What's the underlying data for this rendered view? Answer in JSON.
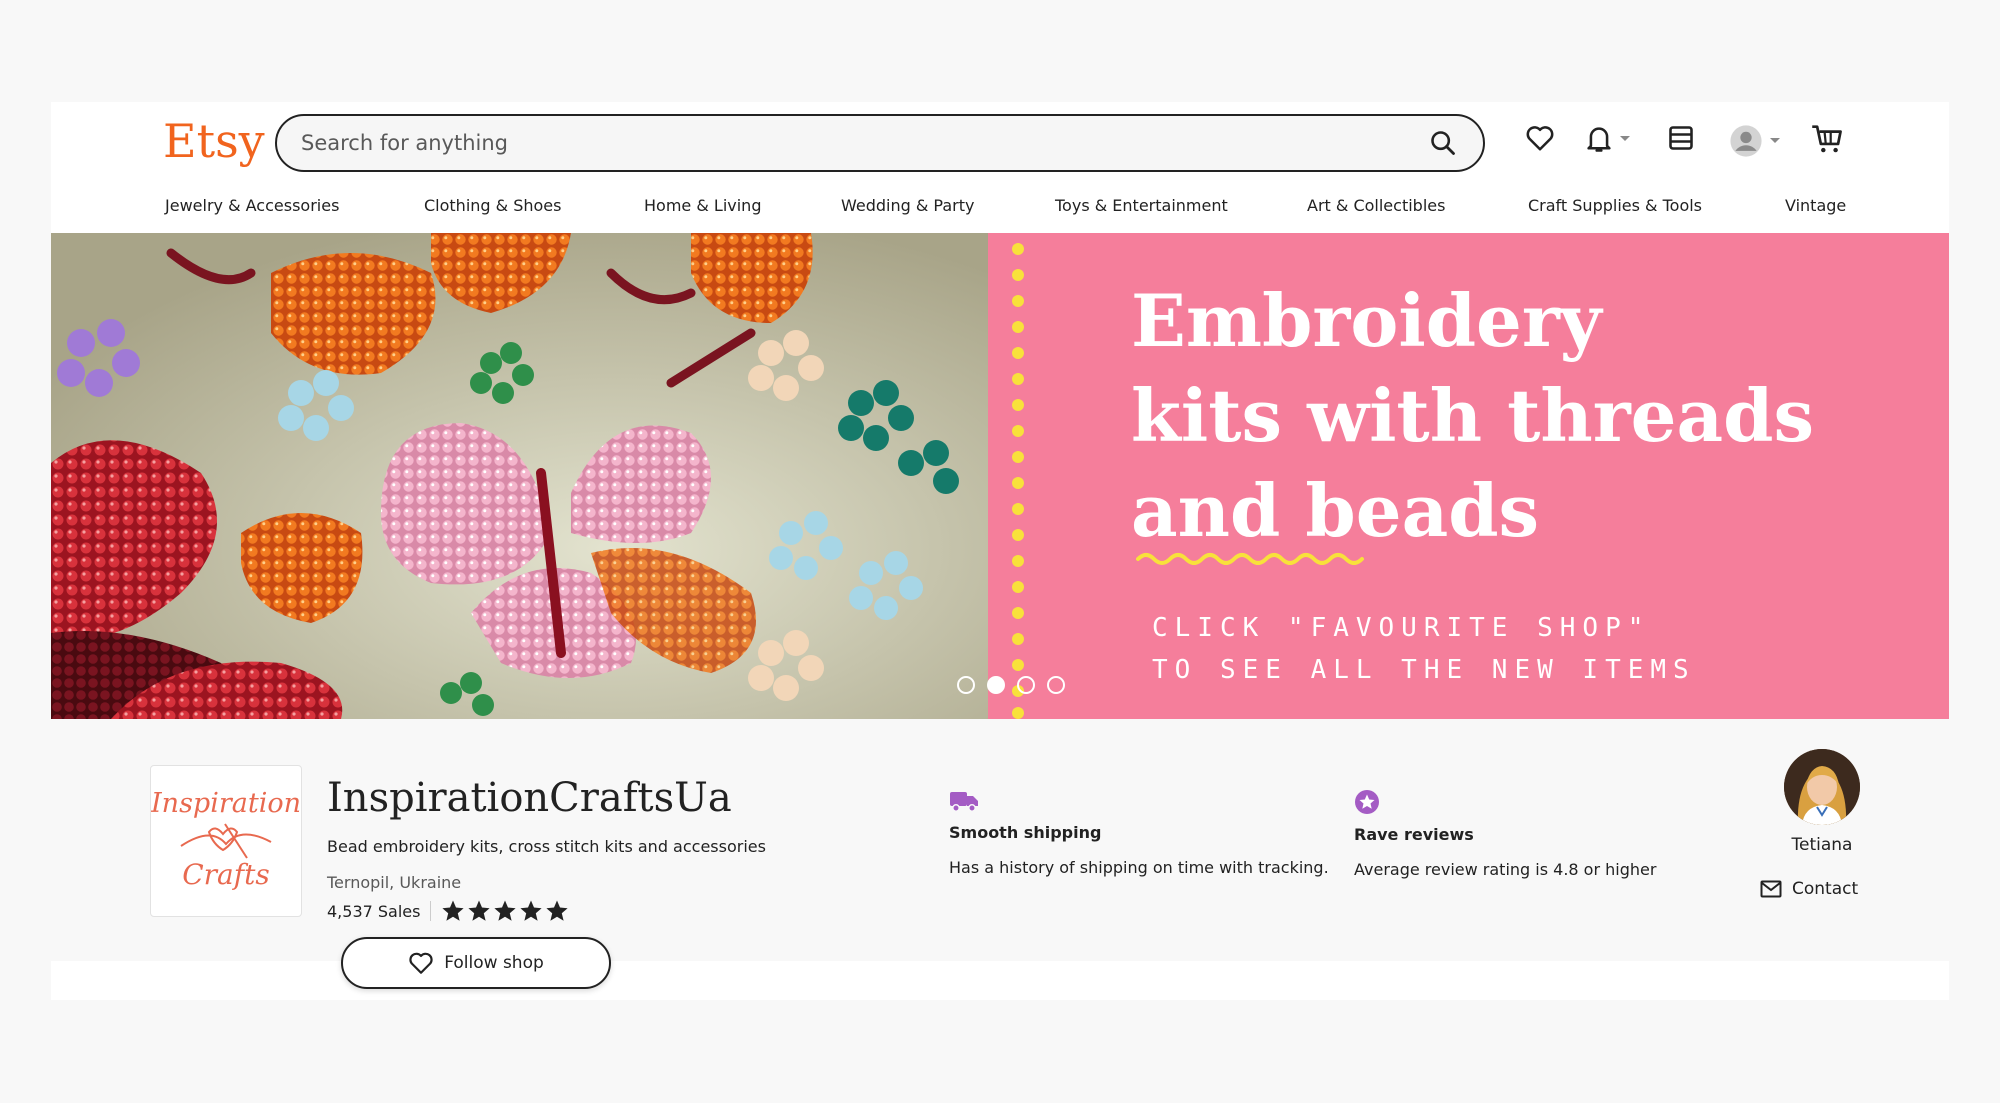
{
  "header": {
    "logo": "Etsy",
    "search_placeholder": "Search for anything",
    "icons": [
      "heart-icon",
      "bell-icon",
      "gift-icon",
      "account-icon",
      "cart-icon"
    ]
  },
  "nav": {
    "items": [
      "Jewelry & Accessories",
      "Clothing & Shoes",
      "Home & Living",
      "Wedding & Party",
      "Toys & Entertainment",
      "Art & Collectibles",
      "Craft Supplies & Tools",
      "Vintage"
    ]
  },
  "banner": {
    "headline": [
      "Embroidery",
      "kits with threads",
      "and beads"
    ],
    "subtext": [
      "CLICK \"FAVOURITE SHOP\"",
      "TO SEE ALL THE NEW ITEMS"
    ],
    "slide_count": 4,
    "active_slide": 2,
    "colors": {
      "pink": "#F57E9B",
      "dots": "#F8E13B"
    }
  },
  "shop": {
    "logo_text": [
      "Inspiration",
      "Crafts"
    ],
    "name": "InspirationCraftsUa",
    "description": "Bead embroidery kits, cross stitch kits and accessories",
    "location": "Ternopil, Ukraine",
    "sales": "4,537 Sales",
    "rating_stars": 5,
    "follow_label": "Follow shop"
  },
  "features": [
    {
      "icon": "truck-icon",
      "title": "Smooth shipping",
      "desc": "Has a history of shipping on time with tracking."
    },
    {
      "icon": "star-badge-icon",
      "title": "Rave reviews",
      "desc": "Average review rating is 4.8 or higher"
    }
  ],
  "owner": {
    "name": "Tetiana",
    "contact_label": "Contact"
  },
  "colors": {
    "brand": "#F1641E",
    "feature_icon": "#A45CC4"
  }
}
